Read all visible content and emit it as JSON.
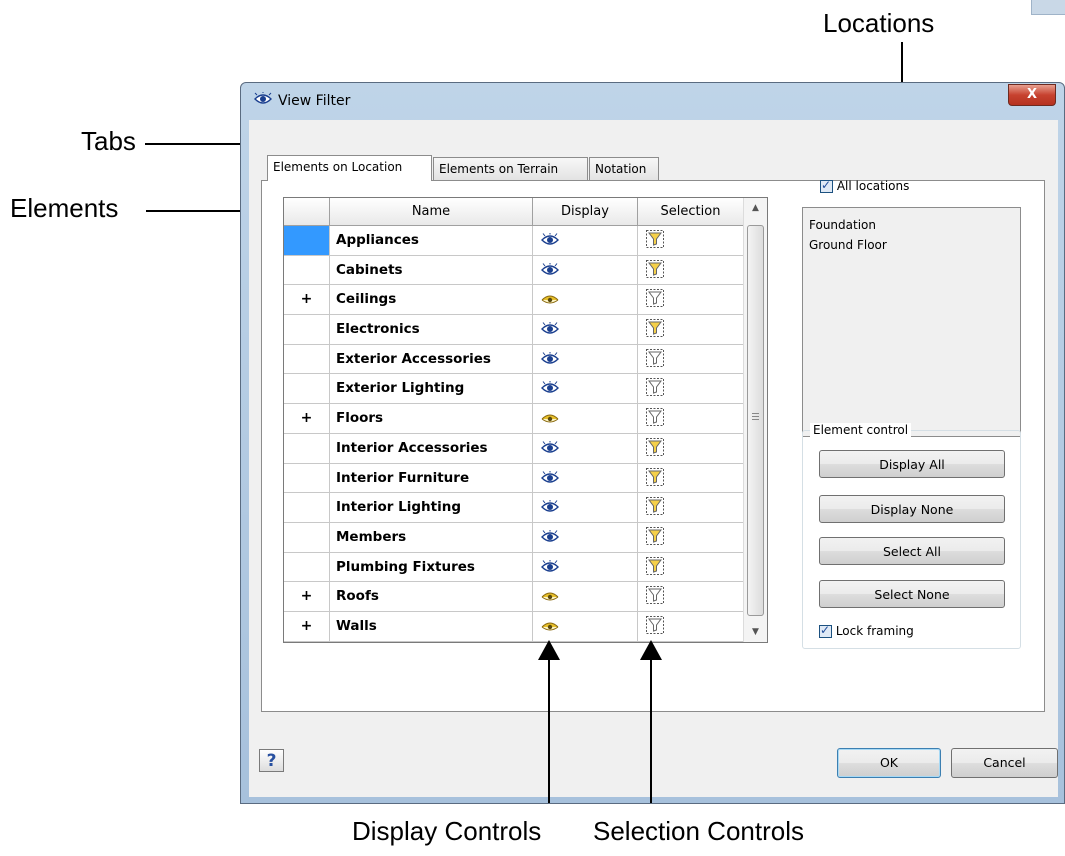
{
  "callouts": {
    "locations": "Locations",
    "tabs": "Tabs",
    "elements": "Elements",
    "display_controls": "Display Controls",
    "selection_controls": "Selection Controls"
  },
  "window": {
    "title": "View Filter",
    "close_glyph": "X",
    "title_icon": "eye-icon"
  },
  "tabs": [
    {
      "label": "Elements on Location",
      "active": true
    },
    {
      "label": "Elements on Terrain",
      "active": false
    },
    {
      "label": "Notation",
      "active": false
    }
  ],
  "grid": {
    "headers": {
      "name": "Name",
      "display": "Display",
      "selection": "Selection"
    },
    "rows": [
      {
        "expand": "",
        "name": "Appliances",
        "display": "visible",
        "selection": "selectable",
        "selected": true
      },
      {
        "expand": "",
        "name": "Cabinets",
        "display": "visible",
        "selection": "selectable"
      },
      {
        "expand": "+",
        "name": "Ceilings",
        "display": "partial",
        "selection": "off"
      },
      {
        "expand": "",
        "name": "Electronics",
        "display": "visible",
        "selection": "selectable"
      },
      {
        "expand": "",
        "name": "Exterior Accessories",
        "display": "visible",
        "selection": "off"
      },
      {
        "expand": "",
        "name": "Exterior Lighting",
        "display": "visible",
        "selection": "off"
      },
      {
        "expand": "+",
        "name": "Floors",
        "display": "partial",
        "selection": "off"
      },
      {
        "expand": "",
        "name": "Interior Accessories",
        "display": "visible",
        "selection": "selectable"
      },
      {
        "expand": "",
        "name": "Interior Furniture",
        "display": "visible",
        "selection": "selectable"
      },
      {
        "expand": "",
        "name": "Interior Lighting",
        "display": "visible",
        "selection": "selectable"
      },
      {
        "expand": "",
        "name": "Members",
        "display": "visible",
        "selection": "selectable"
      },
      {
        "expand": "",
        "name": "Plumbing Fixtures",
        "display": "visible",
        "selection": "selectable"
      },
      {
        "expand": "+",
        "name": "Roofs",
        "display": "partial",
        "selection": "off"
      },
      {
        "expand": "+",
        "name": "Walls",
        "display": "partial",
        "selection": "off"
      }
    ]
  },
  "locations": {
    "all_locations_label": "All locations",
    "all_locations_checked": true,
    "items": [
      "Foundation",
      "Ground Floor"
    ]
  },
  "element_control": {
    "title": "Element control",
    "display_all": "Display All",
    "display_none": "Display None",
    "select_all": "Select All",
    "select_none": "Select None",
    "lock_framing_label": "Lock framing",
    "lock_framing_checked": true
  },
  "footer": {
    "help": "?",
    "ok": "OK",
    "cancel": "Cancel"
  },
  "colors": {
    "selected_row": "#3399ff",
    "eye_blue": "#1a3f8f",
    "eye_yellow": "#e8c02a",
    "filter_yellow": "#f5d04a"
  }
}
